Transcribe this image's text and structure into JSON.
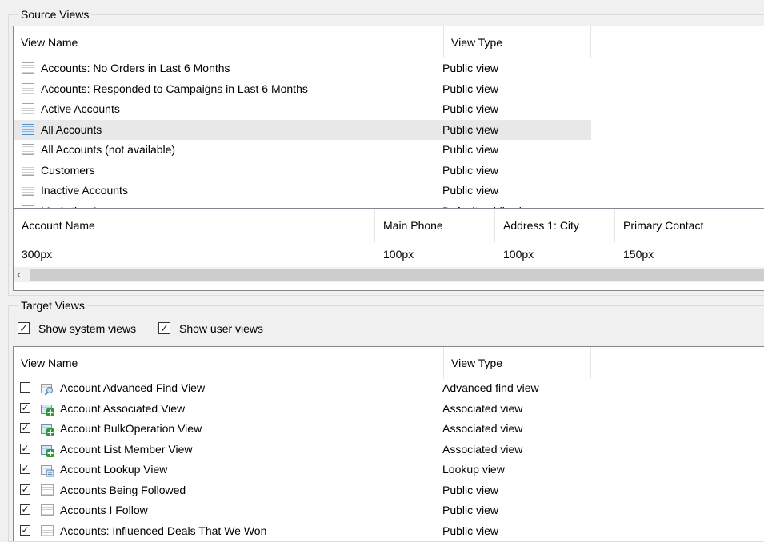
{
  "source_group": {
    "legend": "Source Views",
    "columns": [
      "View Name",
      "View Type"
    ],
    "rows": [
      {
        "name": "Accounts: No Orders in Last 6 Months",
        "type": "Public view"
      },
      {
        "name": "Accounts: Responded to Campaigns in Last 6 Months",
        "type": "Public view"
      },
      {
        "name": "Active Accounts",
        "type": "Public view"
      },
      {
        "name": "All Accounts",
        "type": "Public view",
        "selected": true
      },
      {
        "name": "All Accounts (not available)",
        "type": "Public view"
      },
      {
        "name": "Customers",
        "type": "Public view"
      },
      {
        "name": "Inactive Accounts",
        "type": "Public view"
      },
      {
        "name": "My Active Accounts",
        "type": "Default public view"
      }
    ]
  },
  "columns_panel": {
    "headers": [
      "Account Name",
      "Main Phone",
      "Address 1: City",
      "Primary Contact"
    ],
    "widths": [
      "300px",
      "100px",
      "100px",
      "150px"
    ],
    "scroll_left_glyph": "‹"
  },
  "target_group": {
    "legend": "Target Views",
    "show_system_views": {
      "label": "Show system views",
      "checked": true
    },
    "show_user_views": {
      "label": "Show user views",
      "checked": true
    },
    "columns": [
      "View Name",
      "View Type"
    ],
    "rows": [
      {
        "name": "Account Advanced Find View",
        "type": "Advanced find view",
        "checked": false,
        "icon": "advanced-find-icon"
      },
      {
        "name": "Account Associated View",
        "type": "Associated view",
        "checked": true,
        "icon": "associated-view-icon"
      },
      {
        "name": "Account BulkOperation View",
        "type": "Associated view",
        "checked": true,
        "icon": "associated-view-icon"
      },
      {
        "name": "Account List Member View",
        "type": "Associated view",
        "checked": true,
        "icon": "associated-view-icon"
      },
      {
        "name": "Account Lookup View",
        "type": "Lookup view",
        "checked": true,
        "icon": "lookup-view-icon"
      },
      {
        "name": "Accounts Being Followed",
        "type": "Public view",
        "checked": true,
        "icon": "grid-view-icon"
      },
      {
        "name": "Accounts I Follow",
        "type": "Public view",
        "checked": true,
        "icon": "grid-view-icon"
      },
      {
        "name": "Accounts: Influenced Deals That We Won",
        "type": "Public view",
        "checked": true,
        "icon": "grid-view-icon"
      }
    ]
  },
  "glyphs": {
    "check": "✓"
  }
}
